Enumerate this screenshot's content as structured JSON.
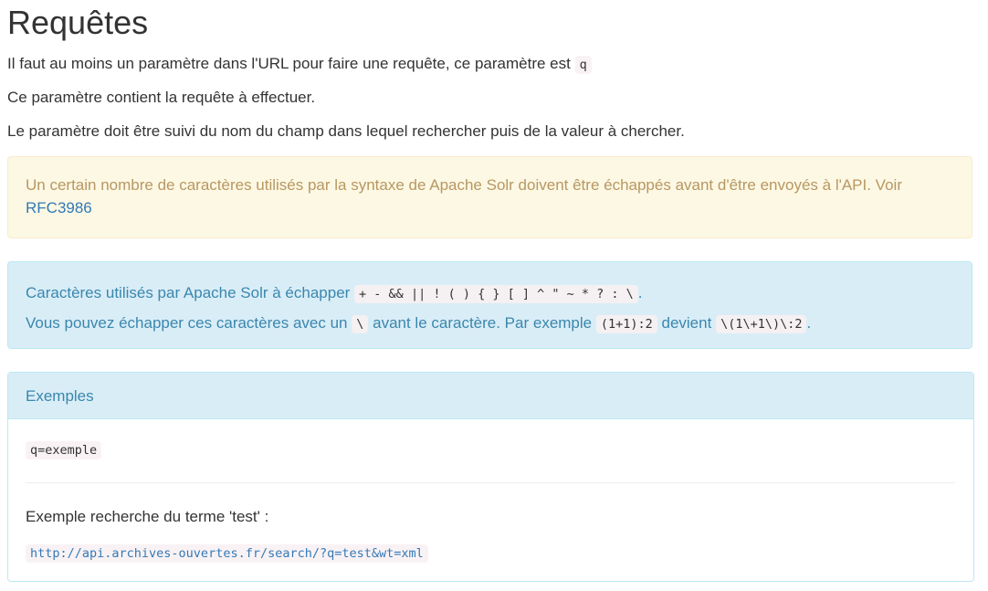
{
  "title": "Requêtes",
  "intro": {
    "line1_text": "Il faut au moins un paramètre dans l'URL pour faire une requête, ce paramètre est",
    "line1_code": "q",
    "line2": "Ce paramètre contient la requête à effectuer.",
    "line3": "Le paramètre doit être suivi du nom du champ dans lequel rechercher puis de la valeur à chercher."
  },
  "warning": {
    "text": "Un certain nombre de caractères utilisés par la syntaxe de Apache Solr doivent être échappés avant d'être envoyés à l'API. Voir",
    "link": "RFC3986"
  },
  "info": {
    "line1_text": "Caractères utilisés par Apache Solr à échapper",
    "line1_code": "+ - && || ! ( ) { } [ ] ^ \" ~ * ? : \\",
    "line1_end": ".",
    "line2_a": "Vous pouvez échapper ces caractères avec un",
    "line2_code1": "\\",
    "line2_b": "avant le caractère. Par exemple",
    "line2_code2": "(1+1):2",
    "line2_c": "devient",
    "line2_code3": "\\(1\\+1\\)\\:2",
    "line2_end": "."
  },
  "examples": {
    "heading": "Exemples",
    "code1": "q=exemple",
    "label": "Exemple recherche du terme 'test' :",
    "url": "http://api.archives-ouvertes.fr/search/?q=test&wt=xml"
  },
  "colors": {
    "warning_bg": "#fcf8e3",
    "info_bg": "#d9edf7",
    "link": "#337ab7"
  }
}
